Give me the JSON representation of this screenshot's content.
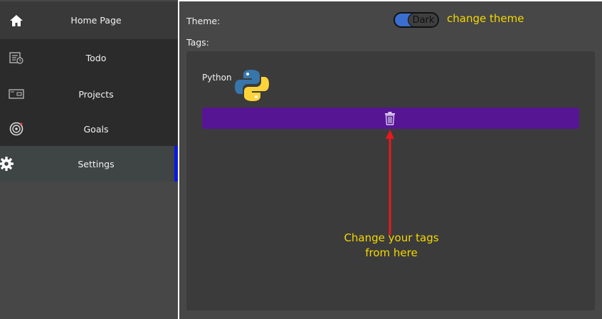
{
  "sidebar": {
    "items": [
      {
        "label": "Home Page",
        "icon": "home-icon"
      },
      {
        "label": "Todo",
        "icon": "todo-list-icon"
      },
      {
        "label": "Projects",
        "icon": "projects-icon"
      },
      {
        "label": "Goals",
        "icon": "target-icon"
      },
      {
        "label": "Settings",
        "icon": "gear-icon"
      }
    ],
    "active_item": "Settings",
    "active_indicator_color": "#0a1ae0"
  },
  "settings": {
    "theme_label": "Theme:",
    "theme_toggle_value": "Dark",
    "tags_label": "Tags:",
    "tags": [
      {
        "name": "Python",
        "logo": "python-logo"
      }
    ],
    "delete_button_icon": "trash-icon",
    "delete_button_color": "#561694"
  },
  "annotations": {
    "theme_note": "change theme",
    "tags_note_line1": "Change your tags",
    "tags_note_line2": "from here",
    "note_color": "#f5d800",
    "arrow_color": "#e8181e"
  }
}
